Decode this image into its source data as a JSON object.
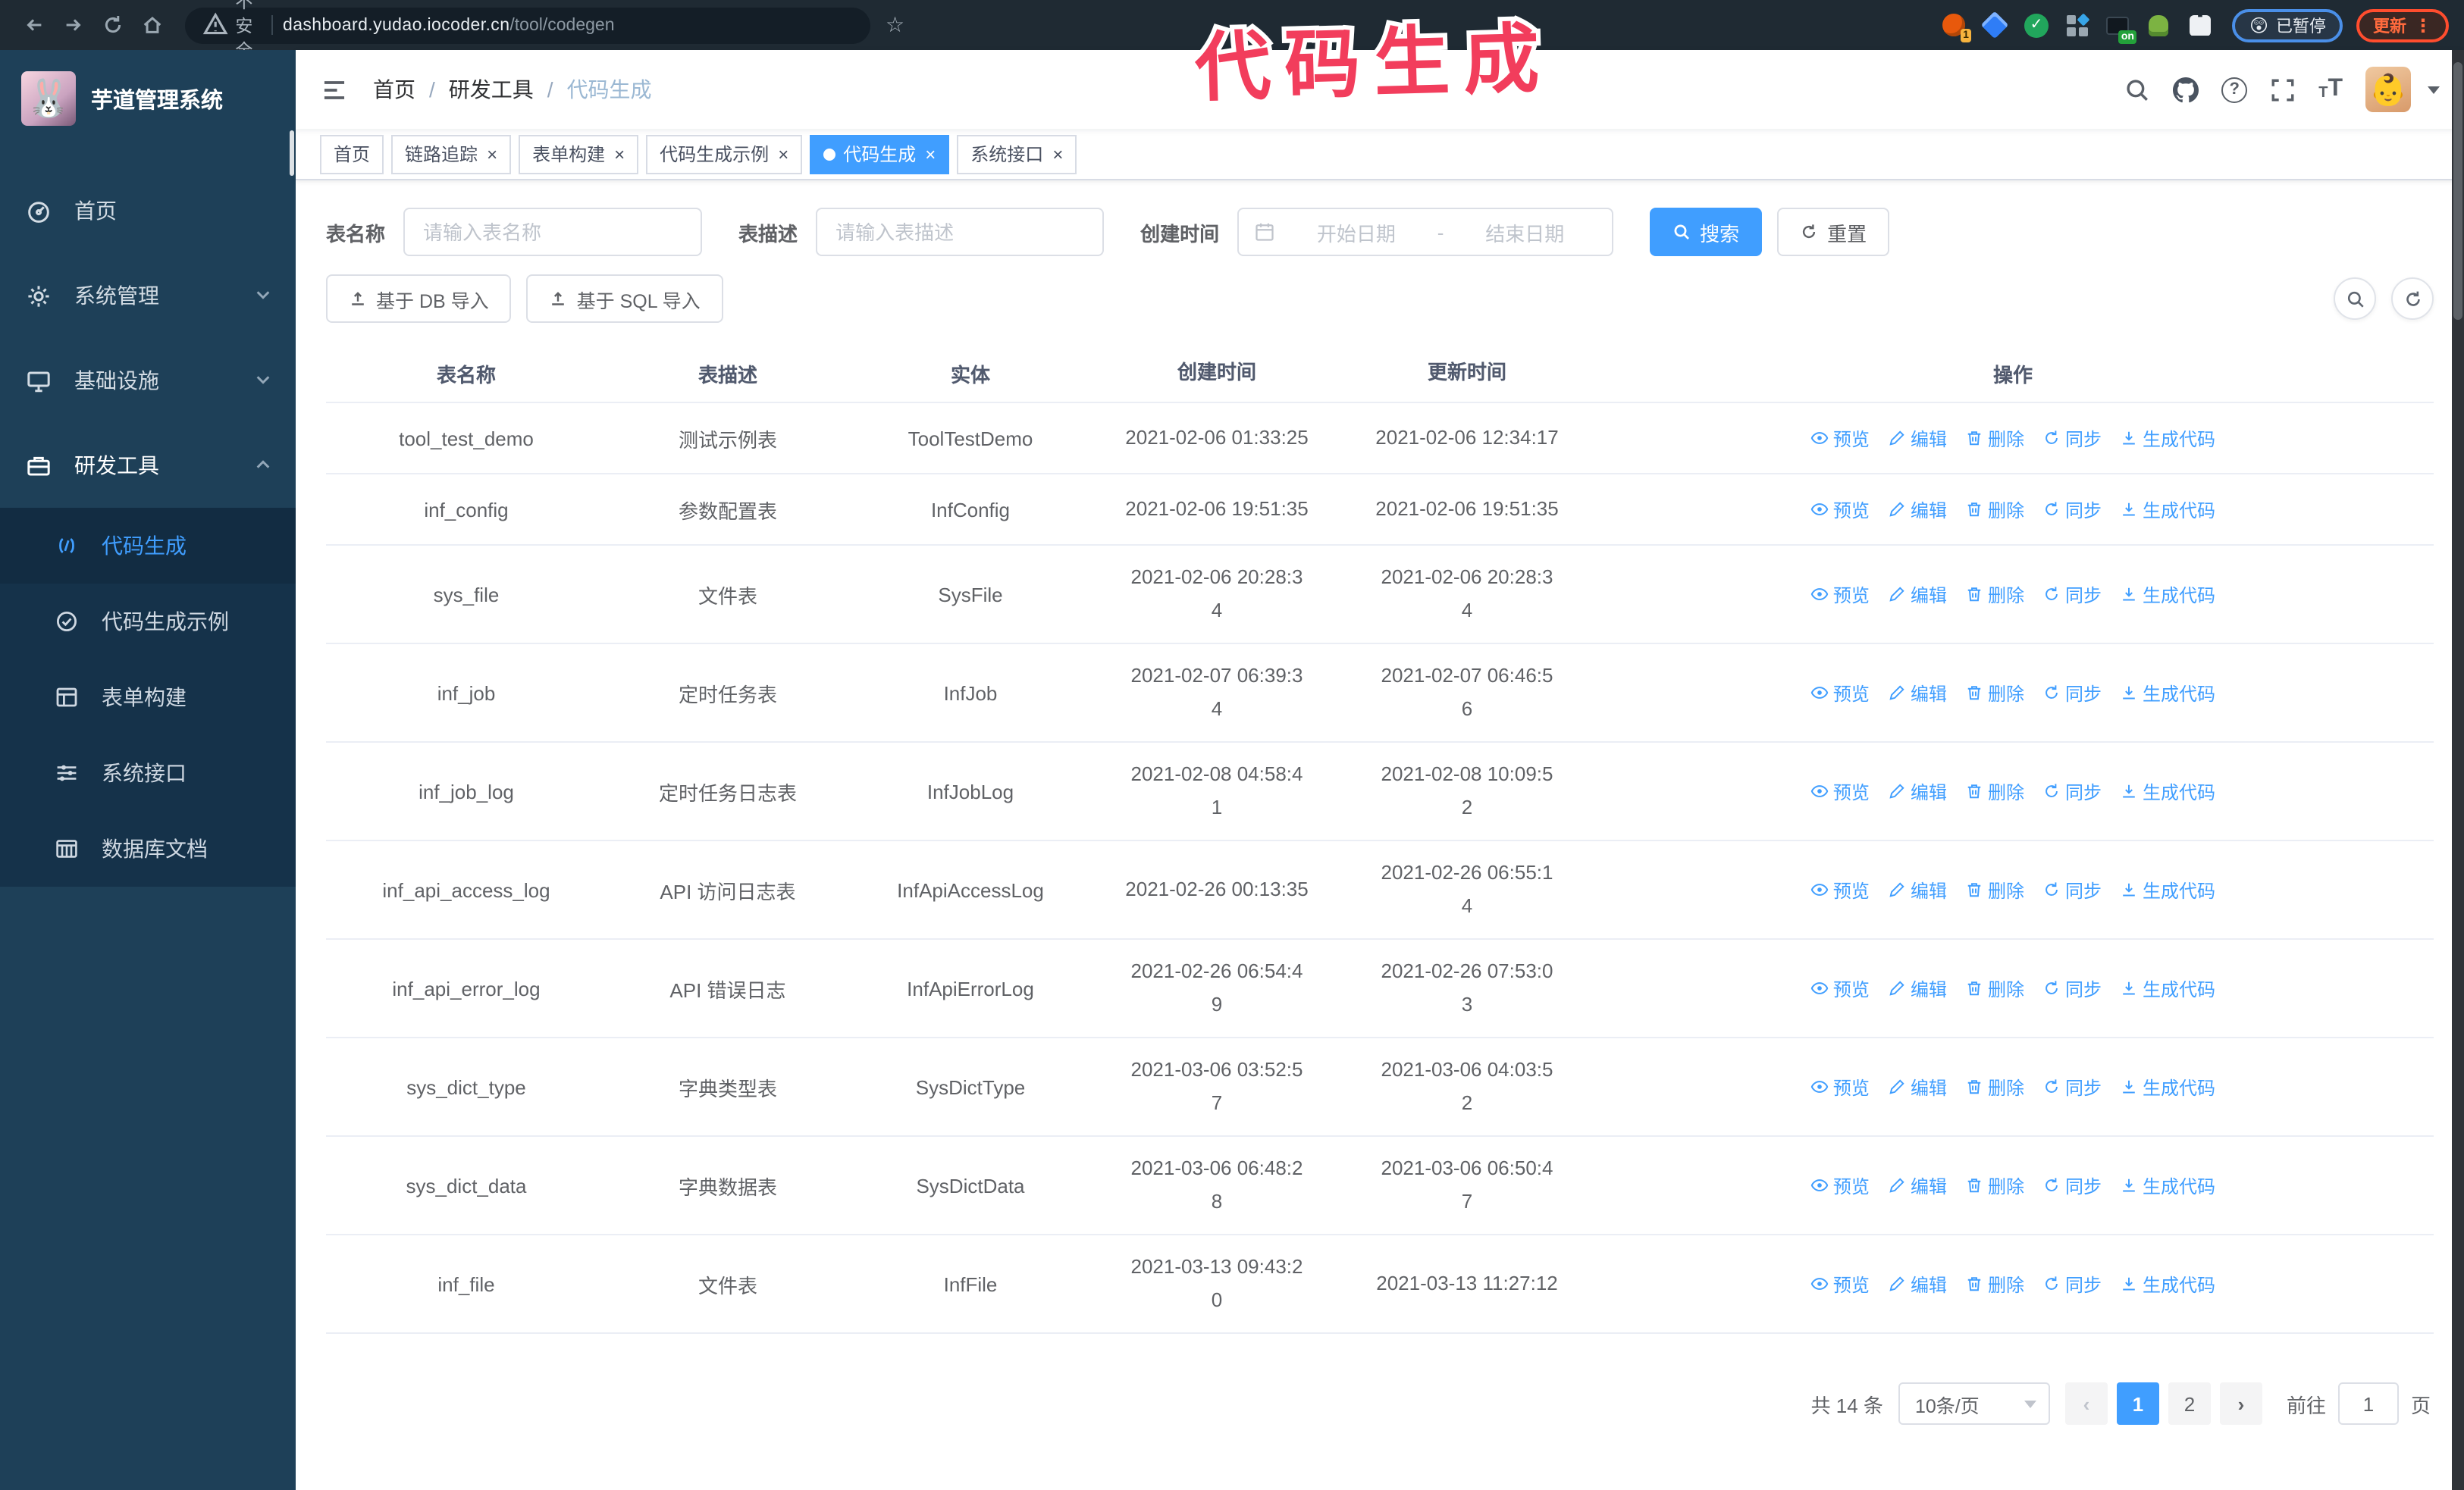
{
  "browser": {
    "security_label": "不安全",
    "url_host": "dashboard.yudao.iocoder.cn",
    "url_path": "/tool/codegen",
    "extension_badge": "1",
    "extension_on_badge": "on",
    "paused_badge": "已暂停",
    "update_badge": "更新"
  },
  "annotation": {
    "text": "代码生成",
    "color": "#f23d5c"
  },
  "icons": {
    "star": "☆",
    "kebab": "⋮",
    "close": "×",
    "question": "?",
    "font_large": "T",
    "font_small": "T",
    "rabbit": "🐰",
    "baby": "👶",
    "surprised_emoji": "😲",
    "check": "✓",
    "breadcrumb_sep": "/",
    "prev_arrow": "‹",
    "next_arrow": "›"
  },
  "sidebar": {
    "title": "芋道管理系统",
    "items": [
      {
        "label": "首页",
        "icon": "dashboard-icon"
      },
      {
        "label": "系统管理",
        "icon": "gear-icon",
        "expand": "down"
      },
      {
        "label": "基础设施",
        "icon": "monitor-icon",
        "expand": "down"
      },
      {
        "label": "研发工具",
        "icon": "toolbox-icon",
        "expand": "up"
      }
    ],
    "subitems": [
      {
        "label": "代码生成",
        "icon": "code-icon",
        "active": true
      },
      {
        "label": "代码生成示例",
        "icon": "circle-check-icon"
      },
      {
        "label": "表单构建",
        "icon": "form-icon"
      },
      {
        "label": "系统接口",
        "icon": "sliders-icon"
      },
      {
        "label": "数据库文档",
        "icon": "database-doc-icon"
      }
    ]
  },
  "navbar": {
    "breadcrumb": [
      "首页",
      "研发工具",
      "代码生成"
    ]
  },
  "tags": [
    {
      "label": "首页",
      "closable": false
    },
    {
      "label": "链路追踪",
      "closable": true
    },
    {
      "label": "表单构建",
      "closable": true
    },
    {
      "label": "代码生成示例",
      "closable": true
    },
    {
      "label": "代码生成",
      "closable": true,
      "active": true
    },
    {
      "label": "系统接口",
      "closable": true
    }
  ],
  "filters": {
    "table_name_label": "表名称",
    "table_name_placeholder": "请输入表名称",
    "table_desc_label": "表描述",
    "table_desc_placeholder": "请输入表描述",
    "create_time_label": "创建时间",
    "date_start_placeholder": "开始日期",
    "date_separator": "-",
    "date_end_placeholder": "结束日期",
    "search_label": "搜索",
    "reset_label": "重置"
  },
  "toolbar": {
    "import_db_label": "基于 DB 导入",
    "import_sql_label": "基于 SQL 导入"
  },
  "table": {
    "columns": [
      "表名称",
      "表描述",
      "实体",
      "创建时间",
      "更新时间",
      "操作"
    ],
    "actions": [
      "预览",
      "编辑",
      "删除",
      "同步",
      "生成代码"
    ],
    "rows": [
      {
        "name": "tool_test_demo",
        "desc": "测试示例表",
        "entity": "ToolTestDemo",
        "created": "2021-02-06 01:33:25",
        "created_two_line": false,
        "updated": "2021-02-06 12:34:17",
        "updated_two_line": false
      },
      {
        "name": "inf_config",
        "desc": "参数配置表",
        "entity": "InfConfig",
        "created": "2021-02-06 19:51:35",
        "created_two_line": false,
        "updated": "2021-02-06 19:51:35",
        "updated_two_line": false
      },
      {
        "name": "sys_file",
        "desc": "文件表",
        "entity": "SysFile",
        "created": "2021-02-06 20:28:34",
        "created_two_line": true,
        "updated": "2021-02-06 20:28:34",
        "updated_two_line": true
      },
      {
        "name": "inf_job",
        "desc": "定时任务表",
        "entity": "InfJob",
        "created": "2021-02-07 06:39:34",
        "created_two_line": true,
        "updated": "2021-02-07 06:46:56",
        "updated_two_line": true
      },
      {
        "name": "inf_job_log",
        "desc": "定时任务日志表",
        "entity": "InfJobLog",
        "created": "2021-02-08 04:58:41",
        "created_two_line": true,
        "updated": "2021-02-08 10:09:52",
        "updated_two_line": true
      },
      {
        "name": "inf_api_access_log",
        "desc": "API 访问日志表",
        "entity": "InfApiAccessLog",
        "created": "2021-02-26 00:13:35",
        "created_two_line": false,
        "updated": "2021-02-26 06:55:14",
        "updated_two_line": true
      },
      {
        "name": "inf_api_error_log",
        "desc": "API 错误日志",
        "entity": "InfApiErrorLog",
        "created": "2021-02-26 06:54:49",
        "created_two_line": true,
        "updated": "2021-02-26 07:53:03",
        "updated_two_line": true
      },
      {
        "name": "sys_dict_type",
        "desc": "字典类型表",
        "entity": "SysDictType",
        "created": "2021-03-06 03:52:57",
        "created_two_line": true,
        "updated": "2021-03-06 04:03:52",
        "updated_two_line": true
      },
      {
        "name": "sys_dict_data",
        "desc": "字典数据表",
        "entity": "SysDictData",
        "created": "2021-03-06 06:48:28",
        "created_two_line": true,
        "updated": "2021-03-06 06:50:47",
        "updated_two_line": true
      },
      {
        "name": "inf_file",
        "desc": "文件表",
        "entity": "InfFile",
        "created": "2021-03-13 09:43:20",
        "created_two_line": true,
        "updated": "2021-03-13 11:27:12",
        "updated_two_line": false
      }
    ]
  },
  "pagination": {
    "total_label": "共 14 条",
    "page_size": "10条/页",
    "pages": [
      "1",
      "2"
    ],
    "active_page": "1",
    "goto_label": "前往",
    "goto_value": "1",
    "goto_suffix": "页"
  },
  "colors": {
    "accent": "#409eff",
    "annotation": "#f23d5c",
    "sidebar_bg": "#1e4058",
    "submenu_bg": "#15324a",
    "browser_bar_bg": "#1f2a33",
    "update_badge": "#ff6a3d",
    "paused_border": "#4a8fe8"
  }
}
